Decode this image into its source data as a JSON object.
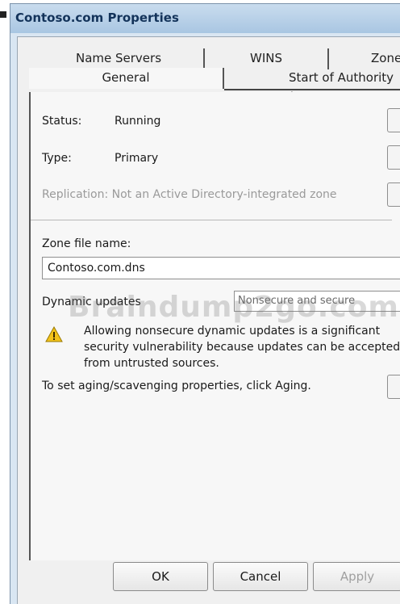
{
  "window": {
    "title": "Contoso.com Properties"
  },
  "tabs": {
    "row_back": [
      "Name Servers",
      "WINS",
      "Zone T"
    ],
    "row_front": [
      "General",
      "Start of Authority (S"
    ]
  },
  "general": {
    "status_label": "Status:",
    "status_value": "Running",
    "type_label": "Type:",
    "type_value": "Primary",
    "replication_text": "Replication:  Not an Active Directory-integrated zone",
    "zone_file_label": "Zone file name:",
    "zone_file_value": "Contoso.com.dns",
    "dynamic_updates_label": "Dynamic updates",
    "dynamic_updates_value": "Nonsecure and secure",
    "warning_text": "Allowing nonsecure dynamic updates is a significant security vulnerability because updates can be accepted from untrusted sources.",
    "aging_text": "To set aging/scavenging properties, click Aging."
  },
  "buttons": {
    "ok": "OK",
    "cancel": "Cancel",
    "apply": "Apply"
  },
  "colors": {
    "titlebar": "#b9d1ea",
    "title_text": "#13335a",
    "dialog_bg": "#f0f0f0",
    "warning_yellow": "#f2c21b"
  },
  "watermark": "Braindump2go.com"
}
